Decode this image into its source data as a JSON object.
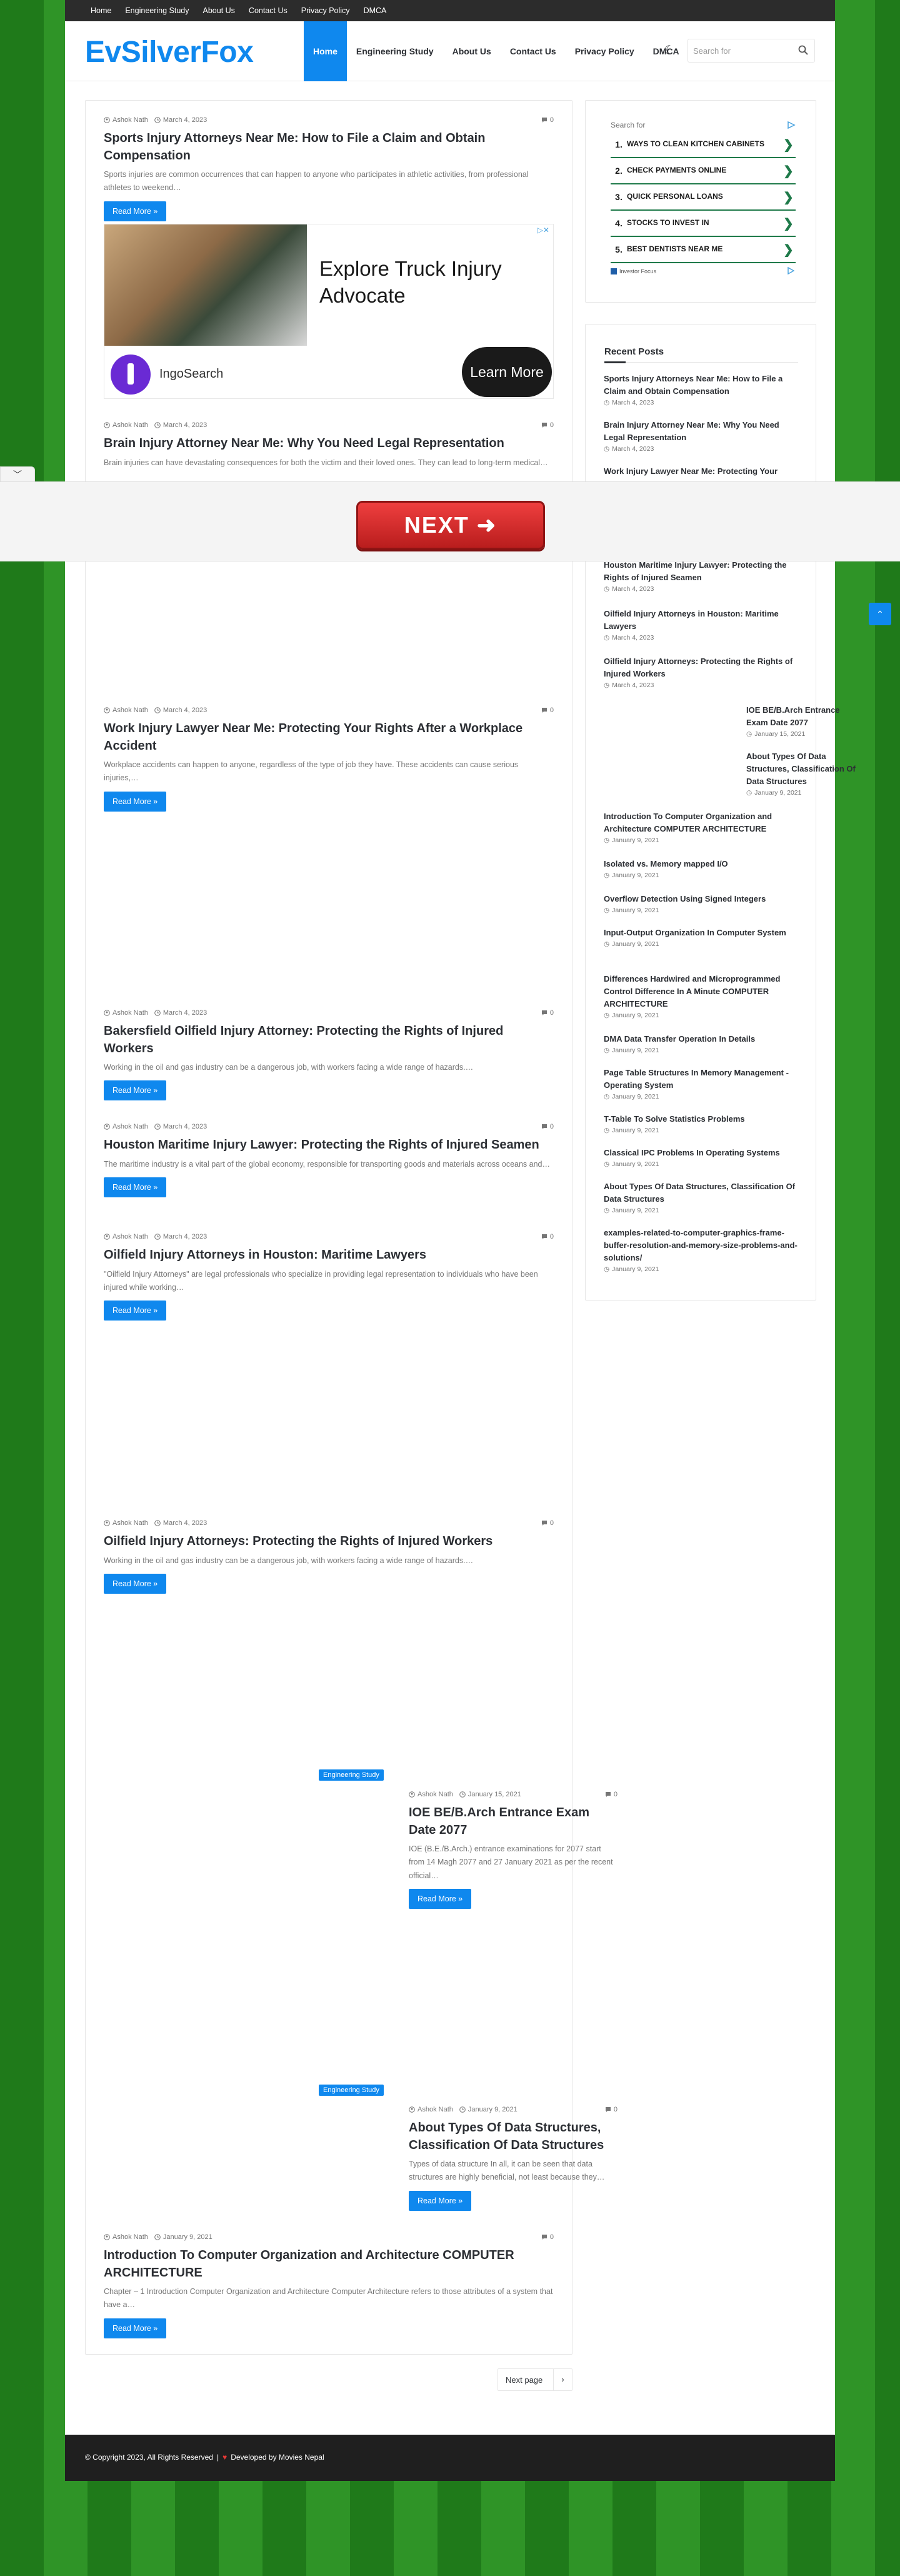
{
  "topbar": {
    "links": [
      "Home",
      "Engineering Study",
      "About Us",
      "Contact Us",
      "Privacy Policy",
      "DMCA"
    ]
  },
  "header": {
    "logo": "EvSilverFox",
    "nav": [
      "Home",
      "Engineering Study",
      "About Us",
      "Contact Us",
      "Privacy Policy",
      "DMCA"
    ],
    "active_nav": "Home",
    "search_placeholder": "Search for"
  },
  "posts": [
    {
      "author": "Ashok Nath",
      "date": "March 4, 2023",
      "comments": "0",
      "title": "Sports Injury Attorneys Near Me: How to File a Claim and Obtain Compensation",
      "excerpt": "Sports injuries are common occurrences that can happen to anyone who participates in athletic activities, from professional athletes to weekend…",
      "read_more": "Read More »"
    },
    {
      "author": "Ashok Nath",
      "date": "March 4, 2023",
      "comments": "0",
      "title": "Brain Injury Attorney Near Me: Why You Need Legal Representation",
      "excerpt": "Brain injuries can have devastating consequences for both the victim and their loved ones. They can lead to long-term medical…",
      "read_more": "Read More »"
    },
    {
      "author": "Ashok Nath",
      "date": "March 4, 2023",
      "comments": "0",
      "title": "Work Injury Lawyer Near Me: Protecting Your Rights After a Workplace Accident",
      "excerpt": "Workplace accidents can happen to anyone, regardless of the type of job they have. These accidents can cause serious injuries,…",
      "read_more": "Read More »"
    },
    {
      "author": "Ashok Nath",
      "date": "March 4, 2023",
      "comments": "0",
      "title": "Bakersfield Oilfield Injury Attorney: Protecting the Rights of Injured Workers",
      "excerpt": "Working in the oil and gas industry can be a dangerous job, with workers facing a wide range of hazards.…",
      "read_more": "Read More »"
    },
    {
      "author": "Ashok Nath",
      "date": "March 4, 2023",
      "comments": "0",
      "title": "Houston Maritime Injury Lawyer: Protecting the Rights of Injured Seamen",
      "excerpt": "The maritime industry is a vital part of the global economy, responsible for transporting goods and materials across oceans and…",
      "read_more": "Read More »"
    },
    {
      "author": "Ashok Nath",
      "date": "March 4, 2023",
      "comments": "0",
      "title": "Oilfield Injury Attorneys in Houston: Maritime Lawyers",
      "excerpt": "\"Oilfield Injury Attorneys\" are legal professionals who specialize in providing legal representation to individuals who have been injured while working…",
      "read_more": "Read More »"
    },
    {
      "author": "Ashok Nath",
      "date": "March 4, 2023",
      "comments": "0",
      "title": "Oilfield Injury Attorneys: Protecting the Rights of Injured Workers",
      "excerpt": "Working in the oil and gas industry can be a dangerous job, with workers facing a wide range of hazards.…",
      "read_more": "Read More »"
    },
    {
      "badge": "Engineering Study",
      "author": "Ashok Nath",
      "date": "January 15, 2021",
      "comments": "0",
      "title": "IOE BE/B.Arch Entrance Exam Date 2077",
      "excerpt": "IOE (B.E./B.Arch.) entrance examinations for 2077 start from 14 Magh 2077 and 27 January 2021 as per the recent official…",
      "read_more": "Read More »"
    },
    {
      "badge": "Engineering Study",
      "author": "Ashok Nath",
      "date": "January 9, 2021",
      "comments": "0",
      "title": "About Types Of Data Structures, Classification Of Data Structures",
      "excerpt": "Types of data structure In all, it can be seen that data structures are highly beneficial, not least because they…",
      "read_more": "Read More »"
    },
    {
      "author": "Ashok Nath",
      "date": "January 9, 2021",
      "comments": "0",
      "title": "Introduction To Computer Organization and Architecture COMPUTER ARCHITECTURE",
      "excerpt": "Chapter – 1 Introduction Computer Organization and Architecture Computer Architecture refers to those attributes of a system that have a…",
      "read_more": "Read More »"
    }
  ],
  "ad": {
    "headline": "Explore Truck Injury Advocate",
    "brand": "IngoSearch",
    "cta": "Learn More",
    "close": "▷✕"
  },
  "overlay": {
    "next": "NEXT ➜",
    "toggle": "﹀"
  },
  "sponsored": {
    "search_label": "Search for",
    "items": [
      {
        "num": "1.",
        "label": "WAYS TO CLEAN KITCHEN CABINETS"
      },
      {
        "num": "2.",
        "label": "CHECK PAYMENTS ONLINE"
      },
      {
        "num": "3.",
        "label": "QUICK PERSONAL LOANS"
      },
      {
        "num": "4.",
        "label": "STOCKS TO INVEST IN"
      },
      {
        "num": "5.",
        "label": "BEST DENTISTS NEAR ME"
      }
    ],
    "footer": "Investor Focus"
  },
  "recent": {
    "title": "Recent Posts",
    "items": [
      {
        "title": "Sports Injury Attorneys Near Me: How to File a Claim and Obtain Compensation",
        "date": "March 4, 2023"
      },
      {
        "title": "Brain Injury Attorney Near Me: Why You Need Legal Representation",
        "date": "March 4, 2023"
      },
      {
        "title": "Work Injury Lawyer Near Me: Protecting Your",
        "date": ""
      },
      {
        "title": "Houston Maritime Injury Lawyer: Protecting the Rights of Injured Seamen",
        "date": "March 4, 2023"
      },
      {
        "title": "Oilfield Injury Attorneys in Houston: Maritime Lawyers",
        "date": "March 4, 2023"
      },
      {
        "title": "Oilfield Injury Attorneys: Protecting the Rights of Injured Workers",
        "date": "March 4, 2023"
      },
      {
        "title": "IOE BE/B.Arch Entrance Exam Date 2077",
        "date": "January 15, 2021"
      },
      {
        "title": "About Types Of Data Structures, Classification Of Data Structures",
        "date": "January 9, 2021"
      },
      {
        "title": "Introduction To Computer Organization and Architecture COMPUTER ARCHITECTURE",
        "date": "January 9, 2021"
      },
      {
        "title": "Isolated vs. Memory mapped I/O",
        "date": "January 9, 2021"
      },
      {
        "title": "Overflow Detection Using Signed Integers",
        "date": "January 9, 2021"
      },
      {
        "title": "Input-Output Organization In Computer System",
        "date": "January 9, 2021"
      },
      {
        "title": "Differences Hardwired and Microprogrammed Control Difference In A Minute COMPUTER ARCHITECTURE",
        "date": "January 9, 2021"
      },
      {
        "title": "DMA Data Transfer Operation In Details",
        "date": "January 9, 2021"
      },
      {
        "title": "Page Table Structures In Memory Management -Operating System",
        "date": "January 9, 2021"
      },
      {
        "title": "T-Table To Solve Statistics Problems",
        "date": "January 9, 2021"
      },
      {
        "title": "Classical IPC Problems In Operating Systems",
        "date": "January 9, 2021"
      },
      {
        "title": "About Types Of Data Structures, Classification Of Data Structures",
        "date": "January 9, 2021"
      },
      {
        "title": "examples-related-to-computer-graphics-frame-buffer-resolution-and-memory-size-problems-and-solutions/",
        "date": "January 9, 2021"
      }
    ]
  },
  "pagination": {
    "next": "Next page",
    "arrow": "›"
  },
  "footer": {
    "copyright": "© Copyright 2023, All Rights Reserved",
    "separator": "|",
    "developed": "Developed by Movies Nepal"
  },
  "colors": {
    "accent": "#0f88ee",
    "topbar": "#2c2c2c",
    "footer": "#1f1f1f",
    "next_button": "#d92b2b"
  }
}
